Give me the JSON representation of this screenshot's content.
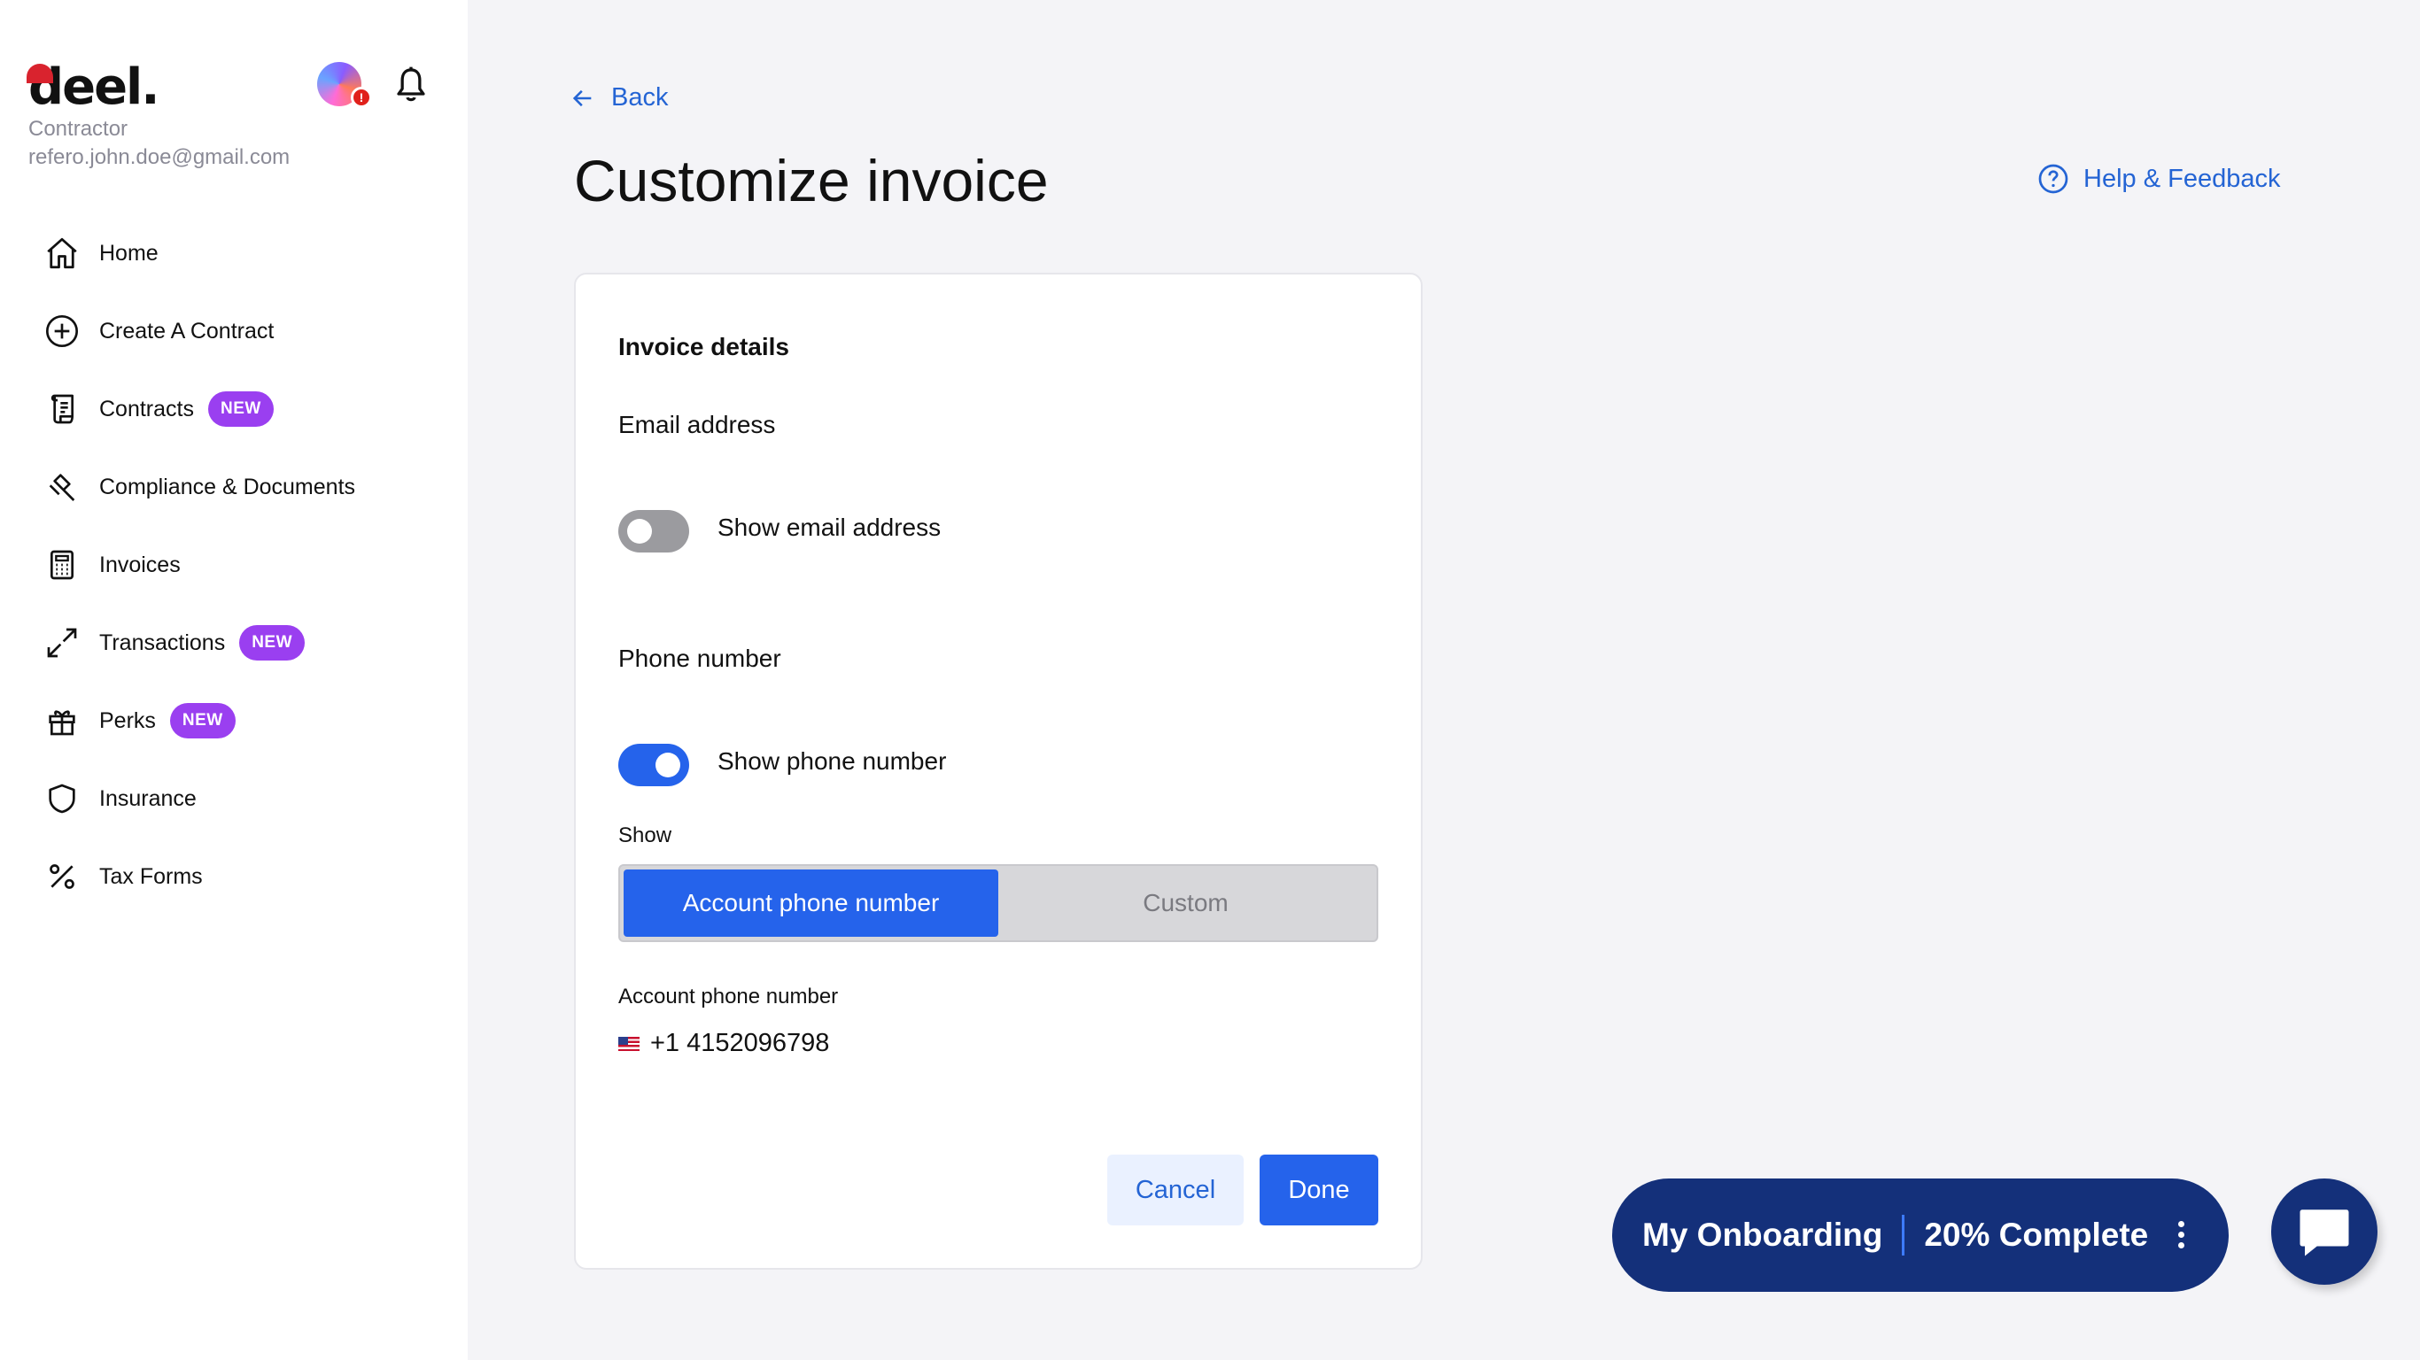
{
  "brand": {
    "logo_text": "deel.",
    "accent": "#2563eb",
    "badge_color": "#9a3ff0",
    "navy": "#14307a"
  },
  "user": {
    "role": "Contractor",
    "email": "refero.john.doe@gmail.com",
    "alert": "!"
  },
  "sidebar": {
    "items": [
      {
        "label": "Home",
        "icon": "home-icon"
      },
      {
        "label": "Create A Contract",
        "icon": "plus-circle-icon"
      },
      {
        "label": "Contracts",
        "icon": "contract-icon",
        "badge": "NEW"
      },
      {
        "label": "Compliance & Documents",
        "icon": "gavel-icon"
      },
      {
        "label": "Invoices",
        "icon": "invoice-icon"
      },
      {
        "label": "Transactions",
        "icon": "arrows-icon",
        "badge": "NEW"
      },
      {
        "label": "Perks",
        "icon": "gift-icon",
        "badge": "NEW"
      },
      {
        "label": "Insurance",
        "icon": "shield-icon"
      },
      {
        "label": "Tax Forms",
        "icon": "percent-icon"
      }
    ]
  },
  "header": {
    "back_label": "Back",
    "title": "Customize invoice",
    "help_label": "Help & Feedback"
  },
  "card": {
    "section_title": "Invoice details",
    "email_section": {
      "label": "Email address",
      "toggle_label": "Show email address",
      "enabled": false
    },
    "phone_section": {
      "label": "Phone number",
      "toggle_label": "Show phone number",
      "enabled": true
    },
    "show_label": "Show",
    "segments": [
      "Account phone number",
      "Custom"
    ],
    "selected_segment": "Account phone number",
    "account_phone_label": "Account phone number",
    "phone_value": "+1 4152096798",
    "cancel_label": "Cancel",
    "done_label": "Done"
  },
  "onboarding": {
    "title": "My Onboarding",
    "progress_text": "20% Complete",
    "progress": 0.2
  }
}
